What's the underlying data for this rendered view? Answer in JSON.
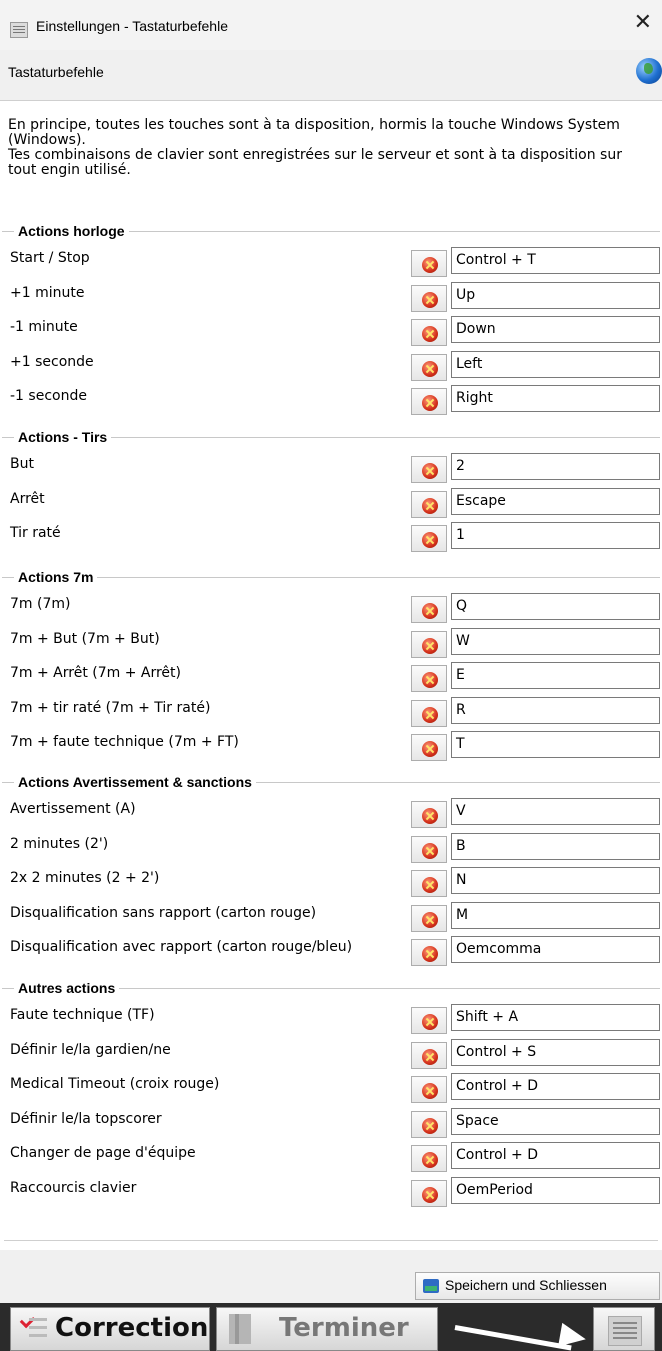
{
  "window": {
    "title": "Einstellungen - Tastaturbefehle",
    "close_icon": "close-icon"
  },
  "header": {
    "title": "Tastaturbefehle",
    "icon": "globe-icon"
  },
  "intro": {
    "line1": "En principe, toutes les touches sont à ta disposition, hormis la touche Windows System (Windows).",
    "line2": "Tes combinaisons de clavier sont enregistrées sur le serveur et sont à ta disposition sur tout engin utilisé."
  },
  "groups": [
    {
      "title": "Actions horloge",
      "rows": [
        {
          "label": "Start / Stop",
          "key": "Control + T"
        },
        {
          "label": "+1 minute",
          "key": "Up"
        },
        {
          "label": "-1 minute",
          "key": "Down"
        },
        {
          "label": "+1 seconde",
          "key": "Left"
        },
        {
          "label": "-1 seconde",
          "key": "Right"
        }
      ]
    },
    {
      "title": "Actions - Tirs",
      "rows": [
        {
          "label": "But",
          "key": "2"
        },
        {
          "label": "Arrêt",
          "key": "Escape"
        },
        {
          "label": "Tir raté",
          "key": "1"
        }
      ]
    },
    {
      "title": "Actions 7m",
      "rows": [
        {
          "label": "7m (7m)",
          "key": "Q"
        },
        {
          "label": "7m + But (7m + But)",
          "key": "W"
        },
        {
          "label": "7m + Arrêt (7m + Arrêt)",
          "key": "E"
        },
        {
          "label": "7m + tir raté (7m + Tir raté)",
          "key": "R"
        },
        {
          "label": "7m + faute technique (7m + FT)",
          "key": "T"
        }
      ]
    },
    {
      "title": "Actions Avertissement & sanctions",
      "rows": [
        {
          "label": "Avertissement (A)",
          "key": "V"
        },
        {
          "label": "2 minutes (2')",
          "key": "B"
        },
        {
          "label": "2x 2 minutes (2 + 2')",
          "key": "N"
        },
        {
          "label": "Disqualification sans rapport (carton rouge)",
          "key": "M"
        },
        {
          "label": "Disqualification avec rapport (carton rouge/bleu)",
          "key": "Oemcomma"
        }
      ]
    },
    {
      "title": "Autres actions",
      "rows": [
        {
          "label": "Faute technique (TF)",
          "key": "Shift + A"
        },
        {
          "label": "Définir le/la gardien/ne",
          "key": "Control + S"
        },
        {
          "label": "Medical Timeout (croix rouge)",
          "key": "Control + D"
        },
        {
          "label": "Définir le/la topscorer",
          "key": "Space"
        },
        {
          "label": "Changer de page d'équipe",
          "key": "Control + D"
        },
        {
          "label": "Raccourcis clavier",
          "key": "OemPeriod"
        }
      ]
    }
  ],
  "footer": {
    "save_label": "Speichern und Schliessen"
  },
  "taskbar": {
    "correction_label": "Correction",
    "terminer_label": "Terminer"
  }
}
